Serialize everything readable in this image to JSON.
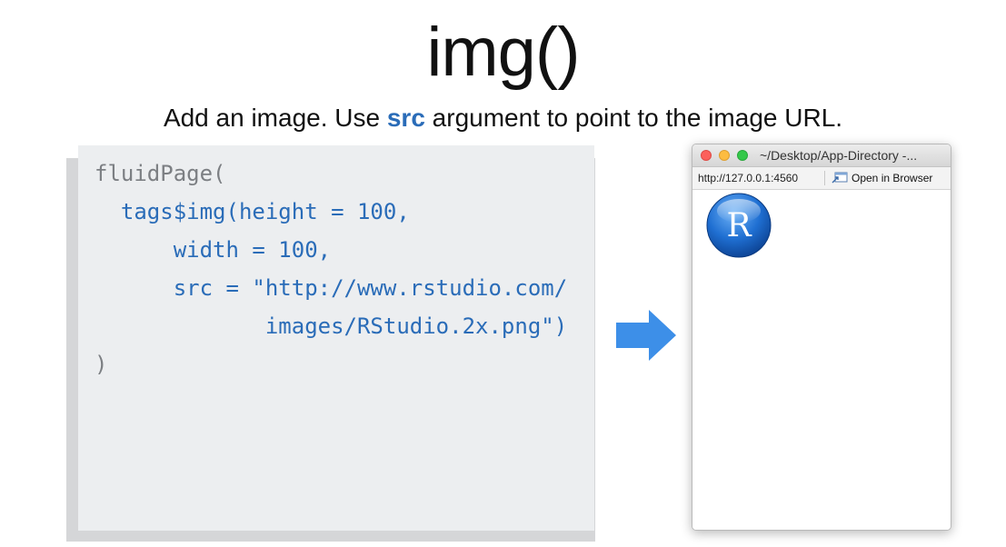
{
  "slide": {
    "title": "img()",
    "subtitle_before": "Add an image. Use ",
    "subtitle_keyword": "src",
    "subtitle_after": " argument to point to the image URL."
  },
  "code": {
    "lines": [
      "fluidPage(",
      "  tags$img(height = 100,",
      "      width = 100,",
      "      src = \"http://www.rstudio.com/",
      "             images/RStudio.2x.png\")",
      ")"
    ]
  },
  "window": {
    "title": "~/Desktop/App-Directory -...",
    "url": "http://127.0.0.1:4560",
    "open_in_browser_label": "Open in Browser",
    "logo_letter": "R"
  },
  "icons": {
    "arrow": "arrow-right-icon",
    "open_browser": "open-in-browser-icon",
    "logo": "r-logo-icon"
  },
  "colors": {
    "keyword": "#2a6cb8",
    "code_text": "#2a6cb8",
    "code_muted": "#7c7f83",
    "arrow": "#3d8fe8",
    "panel_bg": "#eceef0"
  }
}
